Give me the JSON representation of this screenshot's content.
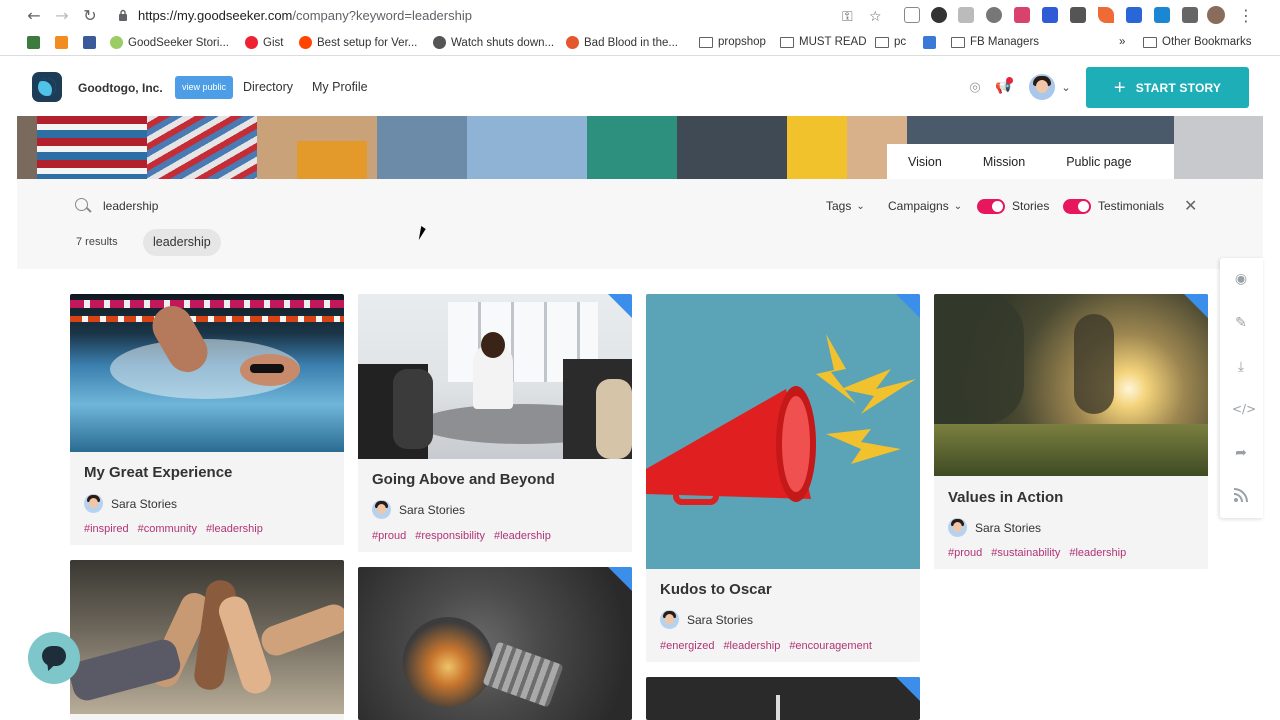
{
  "browser": {
    "url_host": "https://my.goodseeker.com",
    "url_path": "/company?keyword=leadership",
    "bookmarks": [
      "GoodSeeker Stori...",
      "Gist",
      "Best setup for Ver...",
      "Watch shuts down...",
      "Bad Blood in the...",
      "propshop",
      "MUST READ",
      "pc",
      "FB Managers"
    ],
    "overflow": "»",
    "other_bookmarks": "Other Bookmarks"
  },
  "header": {
    "company": "Goodtogo, Inc.",
    "view_public": "view public",
    "nav": [
      "Directory",
      "My Profile"
    ],
    "start_story": "START STORY"
  },
  "banner_tabs": [
    "Vision",
    "Mission",
    "Public page"
  ],
  "search": {
    "value": "leadership",
    "filters": {
      "tags": "Tags",
      "campaigns": "Campaigns"
    },
    "toggles": [
      "Stories",
      "Testimonials"
    ],
    "results": "7 results",
    "chip": "leadership"
  },
  "cards": [
    {
      "title": "My Great Experience",
      "author": "Sara Stories",
      "tags": [
        "#inspired",
        "#community",
        "#leadership"
      ]
    },
    {
      "title": "Going Above and Beyond",
      "author": "Sara Stories",
      "tags": [
        "#proud",
        "#responsibility",
        "#leadership"
      ]
    },
    {
      "title": "Kudos to Oscar",
      "author": "Sara Stories",
      "tags": [
        "#energized",
        "#leadership",
        "#encouragement"
      ]
    },
    {
      "title": "Values in Action",
      "author": "Sara Stories",
      "tags": [
        "#proud",
        "#sustainability",
        "#leadership"
      ]
    }
  ],
  "colors": {
    "accent": "#1eaeb7",
    "toggle": "#e6175c",
    "tag": "#b03476",
    "corner": "#3b8eea"
  }
}
